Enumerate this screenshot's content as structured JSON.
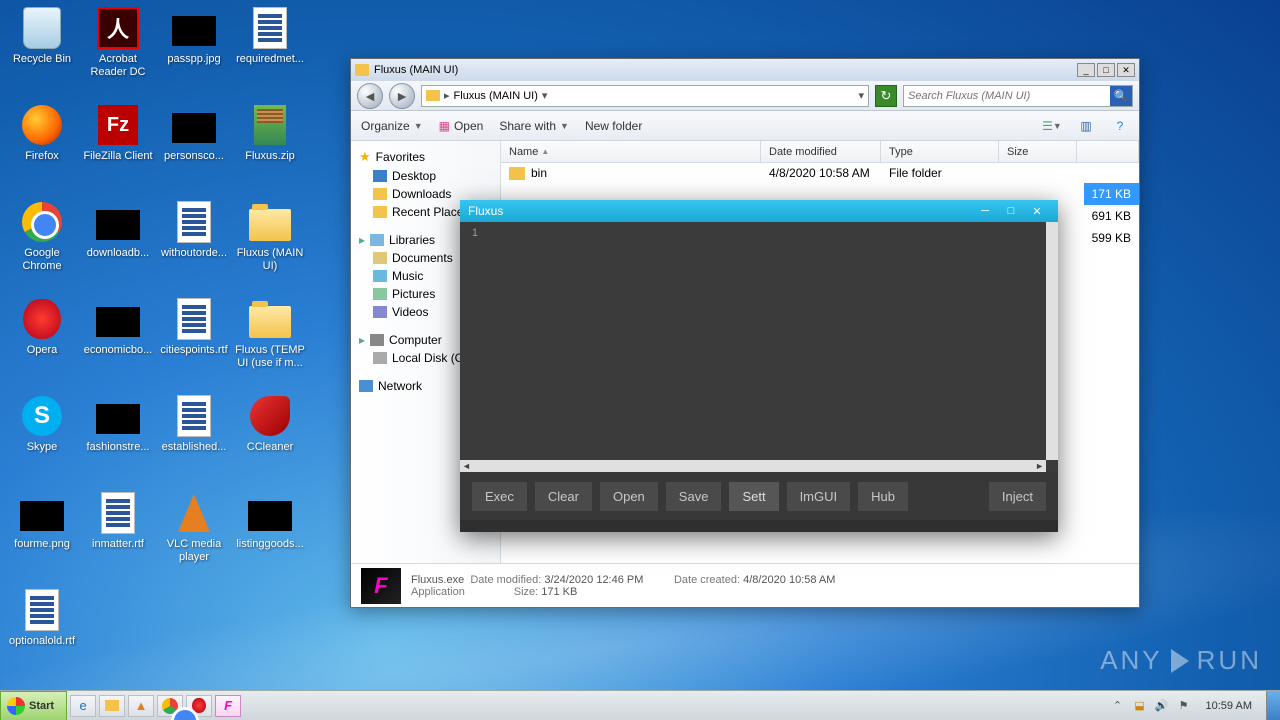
{
  "desktop": {
    "icons": [
      {
        "label": "Recycle Bin",
        "kind": "recycle"
      },
      {
        "label": "Acrobat Reader DC",
        "kind": "adobe"
      },
      {
        "label": "passpp.jpg",
        "kind": "black"
      },
      {
        "label": "requiredmet...",
        "kind": "doc"
      },
      {
        "label": "Firefox",
        "kind": "firefox"
      },
      {
        "label": "FileZilla Client",
        "kind": "filezilla"
      },
      {
        "label": "personsco...",
        "kind": "black"
      },
      {
        "label": "Fluxus.zip",
        "kind": "winrar"
      },
      {
        "label": "Google Chrome",
        "kind": "chrome"
      },
      {
        "label": "downloadb...",
        "kind": "black"
      },
      {
        "label": "withoutorde...",
        "kind": "doc"
      },
      {
        "label": "Fluxus (MAIN UI)",
        "kind": "folder"
      },
      {
        "label": "Opera",
        "kind": "opera"
      },
      {
        "label": "economicbo...",
        "kind": "black"
      },
      {
        "label": "citiespoints.rtf",
        "kind": "doc"
      },
      {
        "label": "Fluxus (TEMP UI (use if m...",
        "kind": "folder"
      },
      {
        "label": "Skype",
        "kind": "skype"
      },
      {
        "label": "fashionstre...",
        "kind": "black"
      },
      {
        "label": "established...",
        "kind": "doc"
      },
      {
        "label": "CCleaner",
        "kind": "ccleaner"
      },
      {
        "label": "fourme.png",
        "kind": "black"
      },
      {
        "label": "inmatter.rtf",
        "kind": "doc"
      },
      {
        "label": "VLC media player",
        "kind": "vlc"
      },
      {
        "label": "listinggoods...",
        "kind": "black"
      },
      {
        "label": "optionalold.rtf",
        "kind": "doc"
      }
    ]
  },
  "explorer": {
    "title": "Fluxus (MAIN UI)",
    "breadcrumb": "Fluxus (MAIN UI)",
    "search_placeholder": "Search Fluxus (MAIN UI)",
    "toolbar": {
      "organize": "Organize",
      "open": "Open",
      "share": "Share with",
      "newfolder": "New folder"
    },
    "nav": {
      "favorites": "Favorites",
      "desktop": "Desktop",
      "downloads": "Downloads",
      "recent": "Recent Places",
      "libraries": "Libraries",
      "documents": "Documents",
      "music": "Music",
      "pictures": "Pictures",
      "videos": "Videos",
      "computer": "Computer",
      "localdisk": "Local Disk (C:)",
      "network": "Network"
    },
    "columns": {
      "name": "Name",
      "date": "Date modified",
      "type": "Type",
      "size": "Size"
    },
    "rows": [
      {
        "name": "bin",
        "date": "4/8/2020 10:58 AM",
        "type": "File folder",
        "size": ""
      }
    ],
    "partial_sizes": [
      "171 KB",
      "691 KB",
      "599 KB"
    ],
    "details": {
      "name": "Fluxus.exe",
      "mod_label": "Date modified:",
      "mod_value": "3/24/2020 12:46 PM",
      "created_label": "Date created:",
      "created_value": "4/8/2020 10:58 AM",
      "type": "Application",
      "size_label": "Size:",
      "size_value": "171 KB"
    }
  },
  "fluxus": {
    "title": "Fluxus",
    "line_number": "1",
    "buttons": {
      "exec": "Exec",
      "clear": "Clear",
      "open": "Open",
      "save": "Save",
      "sett": "Sett",
      "imgui": "ImGUI",
      "hub": "Hub",
      "inject": "Inject"
    }
  },
  "taskbar": {
    "start": "Start",
    "clock": "10:59 AM"
  },
  "watermark": "ANY   RUN"
}
